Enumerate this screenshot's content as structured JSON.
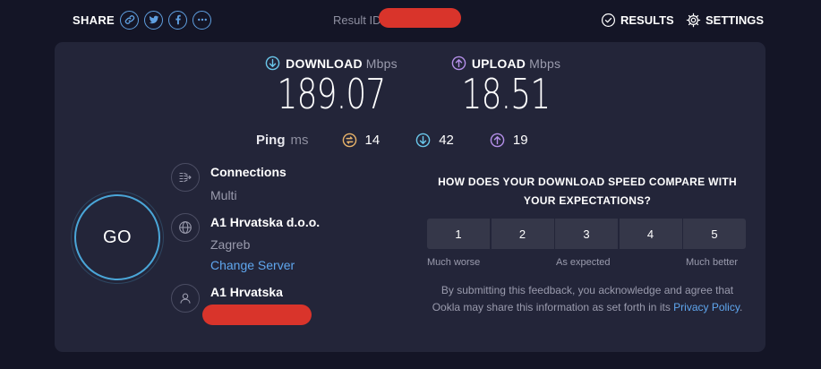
{
  "header": {
    "share_label": "SHARE",
    "share_buttons": [
      {
        "icon": "link-icon"
      },
      {
        "icon": "twitter-icon"
      },
      {
        "icon": "facebook-icon"
      },
      {
        "icon": "more-icon"
      }
    ],
    "result_id_label": "Result ID",
    "results_label": "RESULTS",
    "settings_label": "SETTINGS"
  },
  "download": {
    "label": "DOWNLOAD",
    "unit": "Mbps",
    "value": "189.07",
    "color": "#6ac7ea"
  },
  "upload": {
    "label": "UPLOAD",
    "unit": "Mbps",
    "value": "18.51",
    "color": "#b48fe8"
  },
  "ping": {
    "label": "Ping",
    "unit": "ms",
    "idle": "14",
    "download": "42",
    "upload": "19",
    "idle_color": "#e8b36a"
  },
  "go_label": "GO",
  "connections": {
    "title": "Connections",
    "value": "Multi"
  },
  "server": {
    "name": "A1 Hrvatska d.o.o.",
    "location": "Zagreb",
    "change_link": "Change Server"
  },
  "provider": {
    "name": "A1 Hrvatska"
  },
  "feedback": {
    "question": "HOW DOES YOUR DOWNLOAD SPEED COMPARE WITH YOUR EXPECTATIONS?",
    "ratings": [
      "1",
      "2",
      "3",
      "4",
      "5"
    ],
    "scale_low": "Much worse",
    "scale_mid": "As expected",
    "scale_high": "Much better",
    "disclaimer": "By submitting this feedback, you acknowledge and agree that Ookla may share this information as set forth in its",
    "privacy_link": "Privacy Policy",
    "period": "."
  },
  "colors": {
    "background": "#141526",
    "card": "#232539",
    "accent": "#5fa6ee",
    "redaction": "#d9342b"
  }
}
